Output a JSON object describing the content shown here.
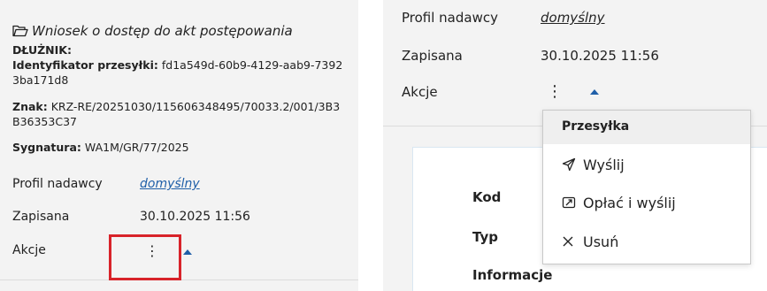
{
  "left": {
    "title": "Wniosek o dostęp do akt postępowania",
    "debtor_label": "DŁUŻNIK:",
    "id_label": "Identyfikator przesyłki:",
    "id_value": "fd1a549d-60b9-4129-aab9-73923ba171d8",
    "znak_label": "Znak:",
    "znak_value": "KRZ-RE/20251030/115606348495/70033.2/001/3B3B36353C37",
    "sygnatura_label": "Sygnatura:",
    "sygnatura_value": "WA1M/GR/77/2025",
    "profile_label": "Profil nadawcy",
    "profile_value": "domyślny",
    "saved_label": "Zapisana",
    "saved_value": "30.10.2025 11:56",
    "actions_label": "Akcje"
  },
  "right": {
    "profile_label": "Profil nadawcy",
    "profile_value": "domyślny",
    "saved_label": "Zapisana",
    "saved_value": "30.10.2025 11:56",
    "actions_label": "Akcje",
    "card_labels": [
      "Kod",
      "Typ",
      "Informacje"
    ]
  },
  "menu": {
    "header": "Przesyłka",
    "items": [
      {
        "label": "Wyślij",
        "icon": "send-icon"
      },
      {
        "label": "Opłać i wyślij",
        "icon": "payment-icon"
      },
      {
        "label": "Usuń",
        "icon": "close-icon"
      }
    ]
  },
  "colors": {
    "link": "#1f5fa8",
    "highlight": "#d8232a",
    "panel_bg": "#f3f3f3"
  }
}
